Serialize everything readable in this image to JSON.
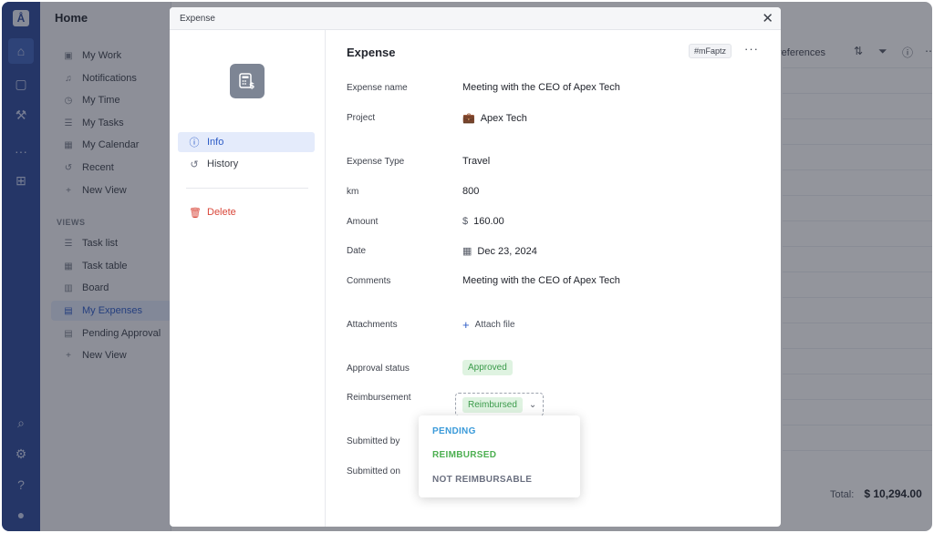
{
  "sidebar": {
    "title": "Home",
    "items": [
      {
        "label": "My Work",
        "icon": "star-box-icon"
      },
      {
        "label": "Notifications",
        "icon": "bell-icon"
      },
      {
        "label": "My Time",
        "icon": "clock-icon"
      },
      {
        "label": "My Tasks",
        "icon": "list-icon"
      },
      {
        "label": "My Calendar",
        "icon": "calendar-icon"
      },
      {
        "label": "Recent",
        "icon": "history-icon"
      },
      {
        "label": "New View",
        "icon": "plus-icon"
      }
    ],
    "views_label": "VIEWS",
    "views": [
      {
        "label": "Task list",
        "icon": "list-icon"
      },
      {
        "label": "Task table",
        "icon": "table-icon"
      },
      {
        "label": "Board",
        "icon": "board-icon"
      },
      {
        "label": "My Expenses",
        "icon": "expense-icon",
        "selected": true
      },
      {
        "label": "Pending Approval",
        "icon": "expense-icon"
      },
      {
        "label": "New View",
        "icon": "plus-icon"
      }
    ]
  },
  "main": {
    "toolbar_preferences": "references",
    "total_label": "Total:",
    "total_value": "$ 10,294.00"
  },
  "modal": {
    "header_title": "Expense",
    "close_glyph": "✕",
    "nav": {
      "info": "Info",
      "history": "History",
      "delete": "Delete"
    },
    "title": "Expense",
    "id_tag": "#mFaptz",
    "more_glyph": "···",
    "fields": {
      "expense_name_label": "Expense name",
      "expense_name_value": "Meeting with the CEO of Apex Tech",
      "project_label": "Project",
      "project_value": "Apex Tech",
      "expense_type_label": "Expense Type",
      "expense_type_value": "Travel",
      "km_label": "km",
      "km_value": "800",
      "amount_label": "Amount",
      "amount_currency": "$",
      "amount_value": "160.00",
      "date_label": "Date",
      "date_value": "Dec 23, 2024",
      "comments_label": "Comments",
      "comments_value": "Meeting with the CEO of Apex Tech",
      "attachments_label": "Attachments",
      "attach_button": "Attach file",
      "approval_label": "Approval status",
      "approval_value": "Approved",
      "reimbursement_label": "Reimbursement",
      "reimbursement_value": "Reimbursed",
      "submitted_by_label": "Submitted by",
      "submitted_on_label": "Submitted on"
    },
    "dropdown": {
      "options": [
        {
          "label": "PENDING",
          "color": "#3a9ad9"
        },
        {
          "label": "REIMBURSED",
          "color": "#4caf50"
        },
        {
          "label": "NOT REIMBURSABLE",
          "color": "#6b7080"
        }
      ]
    }
  },
  "colors": {
    "rail": "#2c4a9a",
    "accent": "#2c5bc6",
    "danger": "#d9473a",
    "success_bg": "#dff3e1",
    "success_text": "#3a9a4a"
  }
}
